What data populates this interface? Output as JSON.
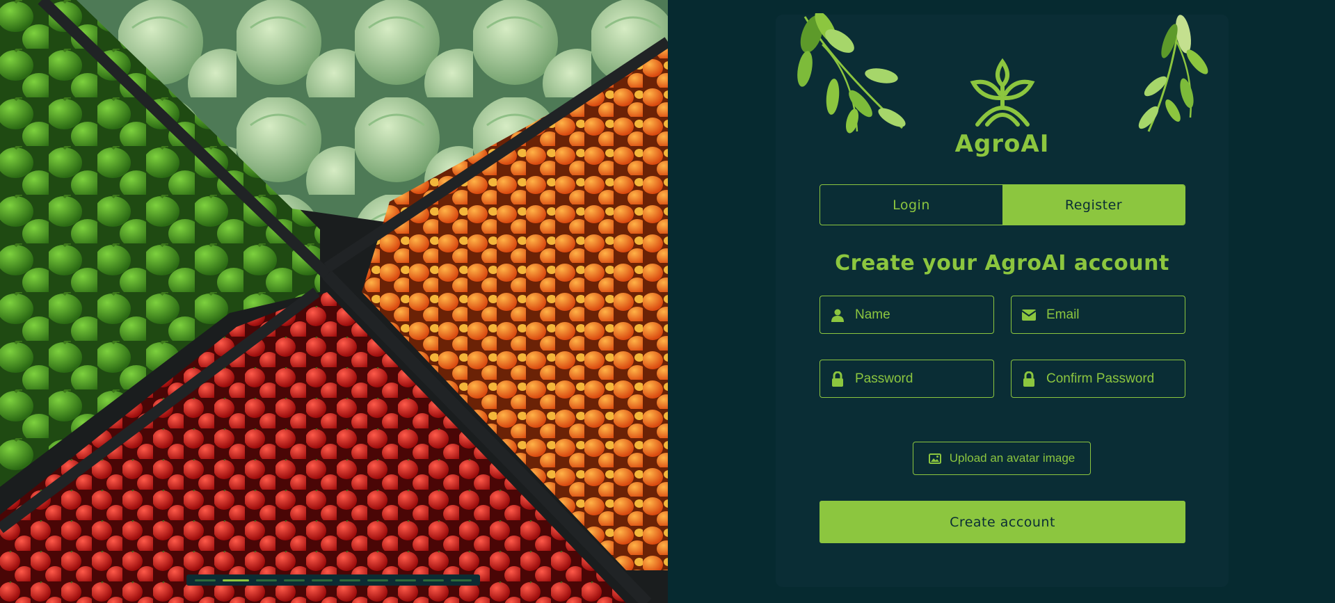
{
  "brand": {
    "name": "AgroAI",
    "accent": "#8cc63f",
    "background": "#062a30",
    "panel": "#0a2d35"
  },
  "tabs": {
    "login": "Login",
    "register": "Register",
    "active": "register"
  },
  "form": {
    "heading": "Create your AgroAI account",
    "name": {
      "placeholder": "Name",
      "icon": "user-icon"
    },
    "email": {
      "placeholder": "Email",
      "icon": "envelope-icon"
    },
    "password": {
      "placeholder": "Password",
      "icon": "lock-icon"
    },
    "confirm_password": {
      "placeholder": "Confirm Password",
      "icon": "lock-icon"
    },
    "upload_label": "Upload an avatar image",
    "submit_label": "Create account"
  },
  "carousel": {
    "slides": 10,
    "active_index": 1
  }
}
